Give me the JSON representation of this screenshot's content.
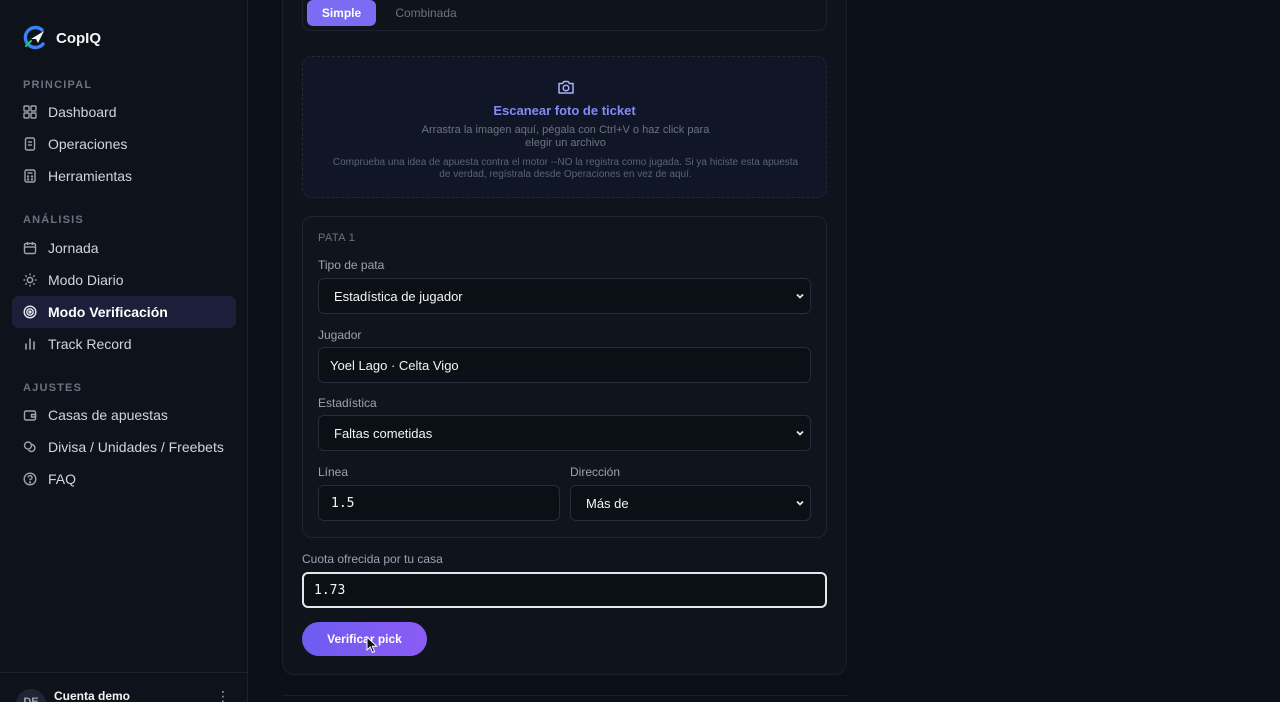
{
  "app": {
    "name": "CopIQ"
  },
  "sidebar": {
    "sections": [
      {
        "label": "PRINCIPAL"
      },
      {
        "label": "ANÁLISIS"
      },
      {
        "label": "AJUSTES"
      }
    ],
    "items": [
      {
        "label": "Dashboard",
        "icon": "dashboard-grid-icon"
      },
      {
        "label": "Operaciones",
        "icon": "document-icon"
      },
      {
        "label": "Herramientas",
        "icon": "calculator-icon"
      },
      {
        "label": "Jornada",
        "icon": "calendar-icon"
      },
      {
        "label": "Modo Diario",
        "icon": "sun-icon"
      },
      {
        "label": "Modo Verificación",
        "icon": "target-icon",
        "active": true
      },
      {
        "label": "Track Record",
        "icon": "bar-chart-icon"
      },
      {
        "label": "Casas de apuestas",
        "icon": "wallet-icon"
      },
      {
        "label": "Divisa / Unidades / Freebets",
        "icon": "coins-icon"
      },
      {
        "label": "FAQ",
        "icon": "help-circle-icon"
      }
    ],
    "account": {
      "initials": "DE",
      "name": "Cuenta demo",
      "menu": "⋮"
    }
  },
  "mode_tabs": {
    "simple": "Simple",
    "combinada": "Combinada",
    "selected": "Simple"
  },
  "scan": {
    "icon": "camera-icon",
    "title": "Escanear foto de ticket",
    "hint": "Arrastra la imagen aquí, pégala con Ctrl+V o haz click para elegir un archivo",
    "note": "Comprueba una idea de apuesta contra el motor --NO la registra como jugada. Si ya hiciste esta apuesta de verdad, regístrala desde Operaciones en vez de aquí."
  },
  "leg": {
    "title": "PATA 1",
    "type_label": "Tipo de pata",
    "type_value": "Estadística de jugador",
    "player_label": "Jugador",
    "player_value": "Yoel Lago · Celta Vigo",
    "stat_label": "Estadística",
    "stat_value": "Faltas cometidas",
    "line_label": "Línea",
    "line_value": "1.5",
    "direction_label": "Dirección",
    "direction_value": "Más de"
  },
  "odds": {
    "label": "Cuota ofrecida por tu casa",
    "value": "1.73"
  },
  "actions": {
    "verify": "Verificar pick"
  },
  "colors": {
    "accent": "#7c6cf4",
    "link": "#818cf8",
    "background": "#0b0f17"
  }
}
